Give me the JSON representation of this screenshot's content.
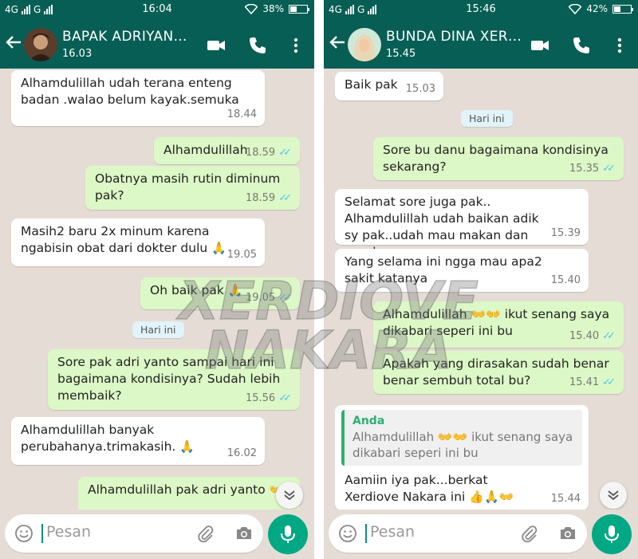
{
  "left": {
    "status": {
      "network": "4G",
      "network2": "G",
      "time": "16:04",
      "battery": "38%",
      "battery_level": 0.38
    },
    "header": {
      "name": "BAPAK ADRIYAN…",
      "subtitle": "16.03"
    },
    "messages": [
      {
        "text": "Alhamdulillah udah terana enteng badan .walao belum kayak.semuka",
        "time": "18.44"
      },
      {
        "text": "Alhamdulillah",
        "time": "18.59"
      },
      {
        "text": "Obatnya masih rutin diminum pak?",
        "time": "18.59"
      },
      {
        "text": "Masih2 baru 2x minum karena ngabisin obat dari dokter dulu",
        "emoji": "🙏",
        "time": "19.05"
      },
      {
        "text": "Oh baik pak",
        "emoji": "🙏",
        "time": "19.05"
      },
      {
        "text": "Sore pak adri yanto sampai hari ini bagaimana kondisinya? Sudah lebih membaik?",
        "time": "15.56"
      },
      {
        "text": "Alhamdulillah banyak perubahanya.trimakasih.",
        "emoji": "🙏",
        "time": "16.02"
      },
      {
        "text": "Alhamdulillah pak adri yanto",
        "emoji": "👐👐",
        "time": ""
      }
    ],
    "day_chip": "Hari ini",
    "input_placeholder": "Pesan"
  },
  "right": {
    "status": {
      "network": "4G",
      "network2": "G",
      "time": "15:46",
      "battery": "42%",
      "battery_level": 0.42
    },
    "header": {
      "name": "BUNDA DINA XER…",
      "subtitle": "15.45"
    },
    "messages": [
      {
        "text": "Baik pak",
        "time": "15.03"
      },
      {
        "text": "Sore bu danu bagaimana kondisinya sekarang?",
        "time": "15.35"
      },
      {
        "text": "Selamat sore juga pak.. Alhamdulillah udah baikan adik sy pak..udah mau makan dan gerak",
        "time": "15.39"
      },
      {
        "text": "Yang selama ini ngga mau apa2 sakit katanya",
        "time": "15.40"
      },
      {
        "text": "Alhamdulillah",
        "emoji": "👐👐",
        "text2": "ikut senang saya dikabari seperi ini bu",
        "time": "15.40"
      },
      {
        "text": "Apakah yang dirasakan sudah benar benar sembuh total bu?",
        "time": "15.41"
      },
      {
        "quote_author": "Anda",
        "quote_text": "Alhamdulillah",
        "quote_emoji": "👐👐",
        "quote_text2": "ikut senang saya dikabari seperi ini bu",
        "text": "Aamiin iya pak...berkat Xerdiove Nakara ini",
        "emoji": "👍🙏👐",
        "time": "15.44"
      }
    ],
    "day_chip": "Hari ini",
    "input_placeholder": "Pesan"
  },
  "watermark": {
    "line1": "XERDIOVE",
    "line2": "NAKARA"
  },
  "colors": {
    "header": "#075e54",
    "chat_bg": "#e5ddd5",
    "outgoing": "#dcf8c6",
    "incoming": "#ffffff",
    "mic": "#00a884",
    "tick": "#4fc3f7"
  },
  "icons": [
    "back-arrow-icon",
    "video-call-icon",
    "phone-icon",
    "more-vert-icon",
    "emoji-icon",
    "attach-icon",
    "camera-icon",
    "mic-icon",
    "chevron-down-icon",
    "double-check-icon"
  ]
}
